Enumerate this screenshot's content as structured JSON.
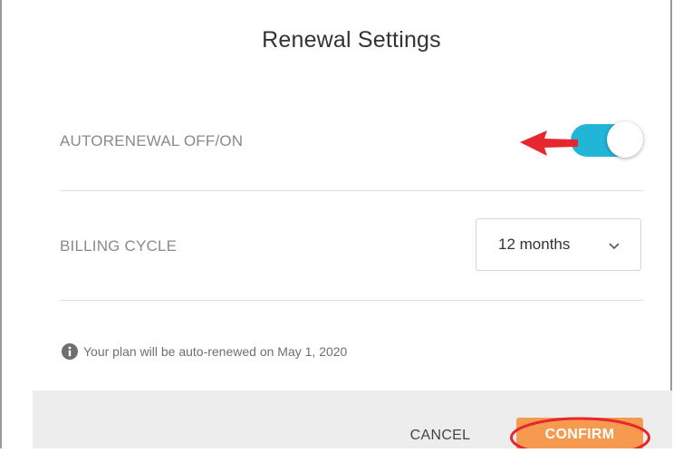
{
  "dialog": {
    "title": "Renewal Settings"
  },
  "autorenewal": {
    "label": "AUTORENEWAL OFF/ON",
    "enabled": true,
    "track_color": "#21b5d8",
    "annotation_icon": "red-arrow-icon"
  },
  "billing": {
    "label": "BILLING CYCLE",
    "selected": "12 months",
    "dropdown_icon": "chevron-down-icon"
  },
  "info": {
    "icon": "info-icon",
    "text": "Your plan will be auto-renewed on May 1, 2020"
  },
  "footer": {
    "cancel_label": "CANCEL",
    "confirm_label": "CONFIRM",
    "confirm_color": "#f59a4f",
    "highlight_color": "#e8262e"
  }
}
